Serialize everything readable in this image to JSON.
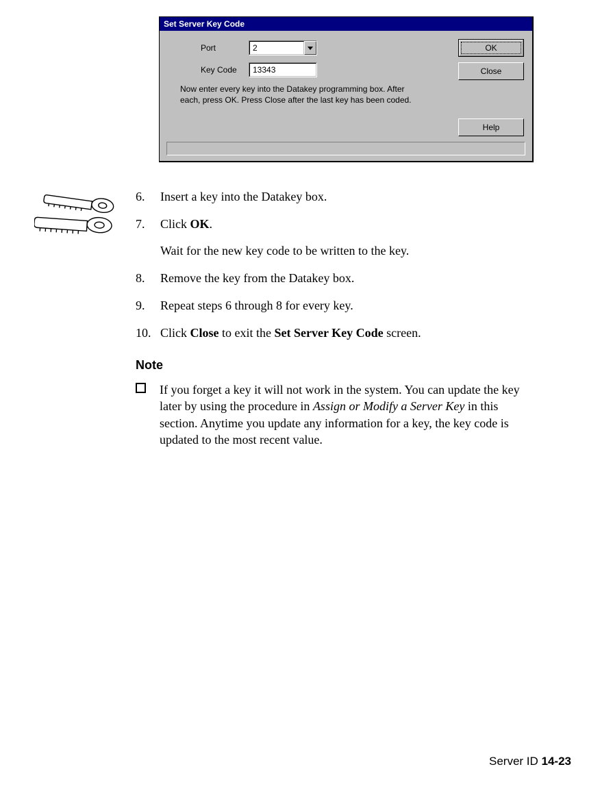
{
  "dialog": {
    "title": "Set Server Key Code",
    "port_label": "Port",
    "port_value": "2",
    "keycode_label": "Key Code",
    "keycode_value": "13343",
    "instruction": "Now enter every key into the Datakey programming box. After each, press OK. Press Close after the last key has been coded.",
    "buttons": {
      "ok": "OK",
      "close": "Close",
      "help": "Help"
    }
  },
  "steps": {
    "s6_num": "6.",
    "s6": "Insert a key into the Datakey box.",
    "s7_num": "7.",
    "s7_a": "Click ",
    "s7_b": "OK",
    "s7_c": ".",
    "s7_cont": "Wait for the new key code to be written to the key.",
    "s8_num": "8.",
    "s8": "Remove the key from the Datakey box.",
    "s9_num": "9.",
    "s9": "Repeat steps 6 through 8 for every key.",
    "s10_num": "10.",
    "s10_a": "Click ",
    "s10_b": "Close",
    "s10_c": " to exit the ",
    "s10_d": "Set Server Key Code",
    "s10_e": " screen."
  },
  "note": {
    "heading": "Note",
    "p1": "If you forget a key it will not work in the system. You can update the key later by using the procedure in ",
    "p2": "Assign or Modify a Server Key",
    "p3": " in this section. Anytime you update any information for a key, the key code is updated to the most recent value."
  },
  "footer": {
    "label": "Server ID  ",
    "page": "14-23"
  }
}
